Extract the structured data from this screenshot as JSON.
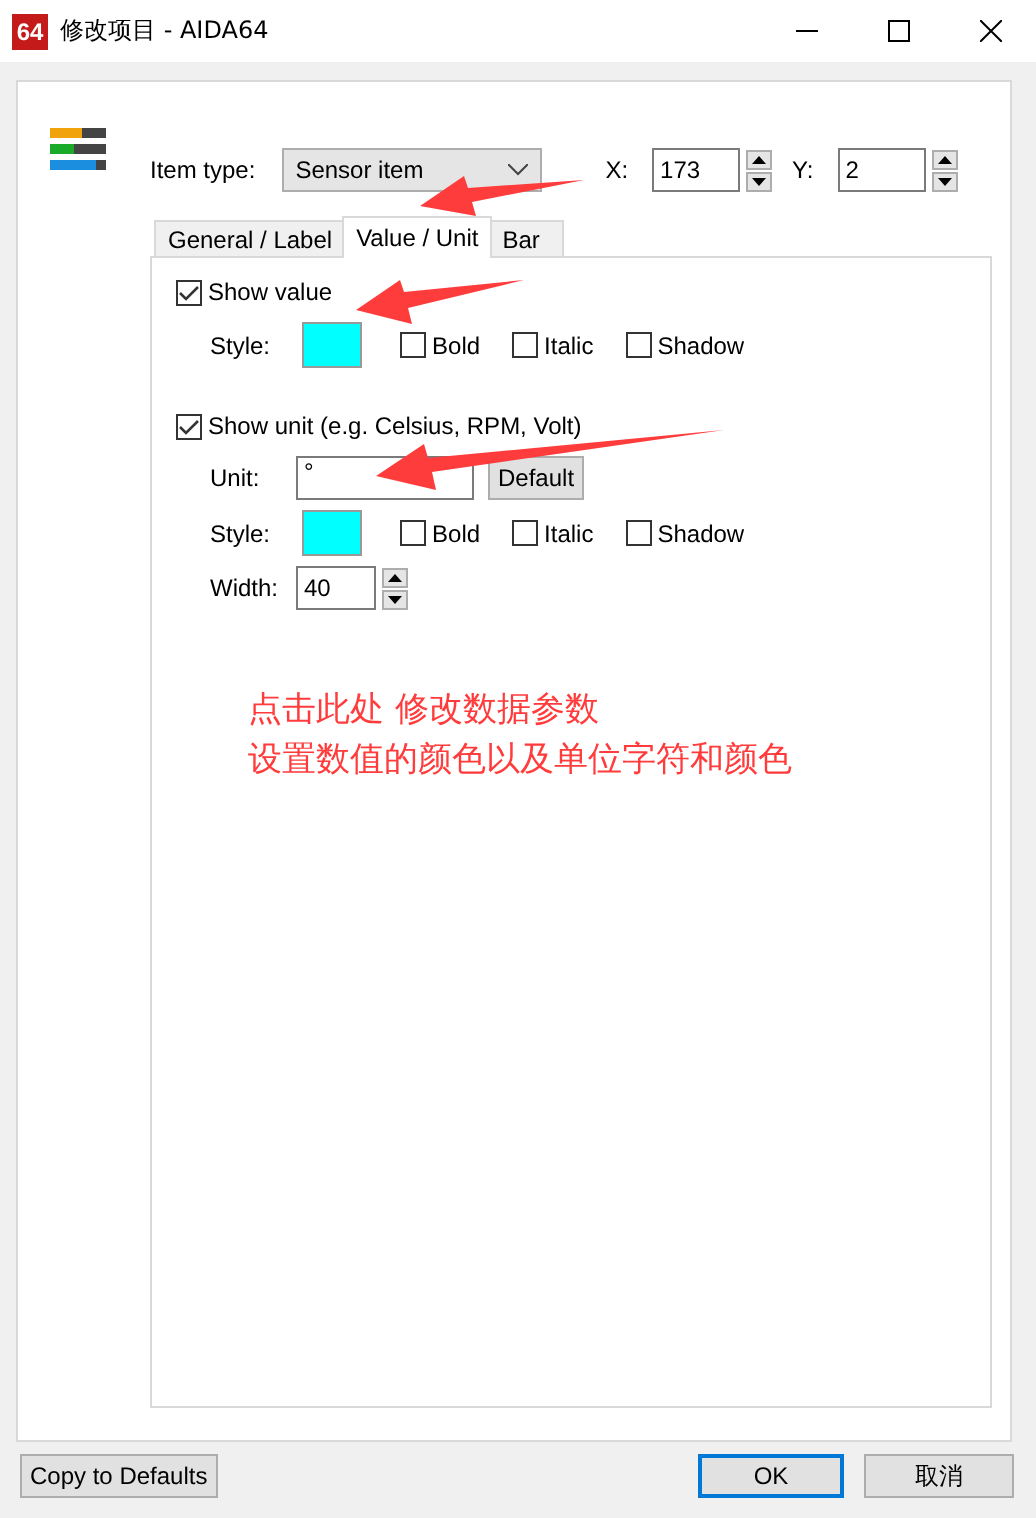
{
  "window": {
    "app_icon": "64",
    "title": "修改项目 - AIDA64"
  },
  "item_type": {
    "label": "Item type:",
    "value": "Sensor item"
  },
  "position": [
    {
      "label": "X:",
      "value": "173"
    },
    {
      "label": "Y:",
      "value": "2"
    }
  ],
  "tabs": [
    {
      "label": "General / Label",
      "selected": false
    },
    {
      "label": "Value / Unit",
      "selected": true
    },
    {
      "label": "Bar",
      "selected": false
    }
  ],
  "value_section": {
    "label": "Show value",
    "checked": true,
    "style_label": "Style:",
    "color": "#00ffff",
    "options": [
      {
        "label": "Bold",
        "checked": false
      },
      {
        "label": "Italic",
        "checked": false
      },
      {
        "label": "Shadow",
        "checked": false
      }
    ]
  },
  "unit_section": {
    "label": "Show unit (e.g. Celsius, RPM, Volt)",
    "checked": true,
    "unit_label": "Unit:",
    "unit_value": "°",
    "default_button": "Default",
    "style_label": "Style:",
    "color": "#00ffff",
    "options": [
      {
        "label": "Bold",
        "checked": false
      },
      {
        "label": "Italic",
        "checked": false
      },
      {
        "label": "Shadow",
        "checked": false
      }
    ],
    "width_label": "Width:",
    "width_value": "40"
  },
  "annotation": [
    "点击此处 修改数据参数",
    "设置数值的颜色以及单位字符和颜色"
  ],
  "buttons": [
    {
      "label": "Copy to Defaults",
      "kind": "left",
      "default": false
    },
    {
      "label": "OK",
      "kind": "right",
      "default": true
    },
    {
      "label": "取消",
      "kind": "right",
      "default": false
    }
  ]
}
